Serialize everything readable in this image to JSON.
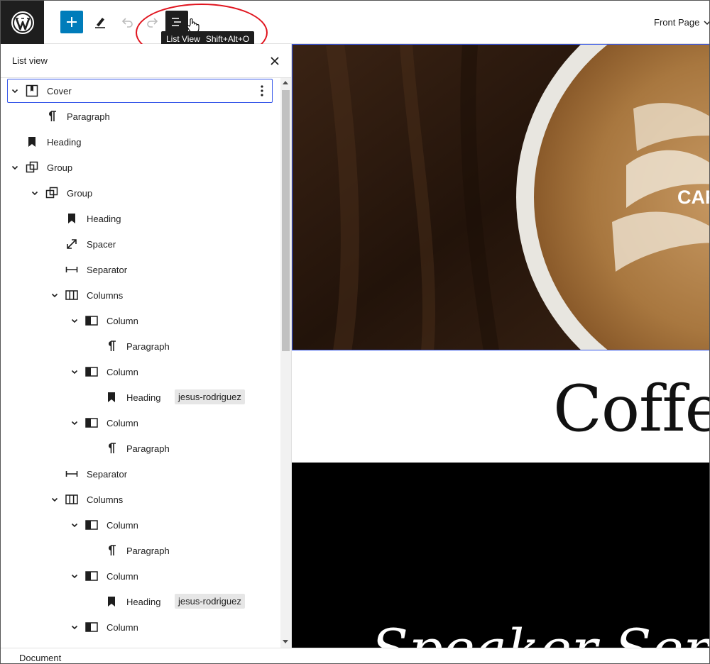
{
  "header": {
    "list_view_tooltip": "List View",
    "list_view_shortcut": "Shift+Alt+O",
    "document_title": "Front Page"
  },
  "sidebar": {
    "title": "List view",
    "items": [
      {
        "label": "Cover",
        "icon": "cover-icon",
        "expanded": true,
        "selected": true
      },
      {
        "label": "Paragraph",
        "icon": "paragraph-icon"
      },
      {
        "label": "Heading",
        "icon": "heading-icon"
      },
      {
        "label": "Group",
        "icon": "group-icon",
        "expanded": true
      },
      {
        "label": "Group",
        "icon": "group-icon",
        "expanded": true
      },
      {
        "label": "Heading",
        "icon": "heading-icon"
      },
      {
        "label": "Spacer",
        "icon": "spacer-icon"
      },
      {
        "label": "Separator",
        "icon": "separator-icon"
      },
      {
        "label": "Columns",
        "icon": "columns-icon",
        "expanded": true
      },
      {
        "label": "Column",
        "icon": "column-icon",
        "expanded": true
      },
      {
        "label": "Paragraph",
        "icon": "paragraph-icon"
      },
      {
        "label": "Column",
        "icon": "column-icon",
        "expanded": true
      },
      {
        "label": "Heading",
        "icon": "heading-icon",
        "badge": "jesus-rodriguez"
      },
      {
        "label": "Column",
        "icon": "column-icon",
        "expanded": true
      },
      {
        "label": "Paragraph",
        "icon": "paragraph-icon"
      },
      {
        "label": "Separator",
        "icon": "separator-icon"
      },
      {
        "label": "Columns",
        "icon": "columns-icon",
        "expanded": true
      },
      {
        "label": "Column",
        "icon": "column-icon",
        "expanded": true
      },
      {
        "label": "Paragraph",
        "icon": "paragraph-icon"
      },
      {
        "label": "Column",
        "icon": "column-icon",
        "expanded": true
      },
      {
        "label": "Heading",
        "icon": "heading-icon",
        "badge": "jesus-rodriguez"
      },
      {
        "label": "Column",
        "icon": "column-icon",
        "expanded": true
      }
    ]
  },
  "canvas": {
    "cover_text": "CAF",
    "heading": "Coffee",
    "speaker_text": "Speaker Series"
  },
  "footer": {
    "breadcrumb": "Document"
  },
  "colors": {
    "accent": "#007cba",
    "selection": "#3858e9",
    "annotation": "#e0141e"
  }
}
